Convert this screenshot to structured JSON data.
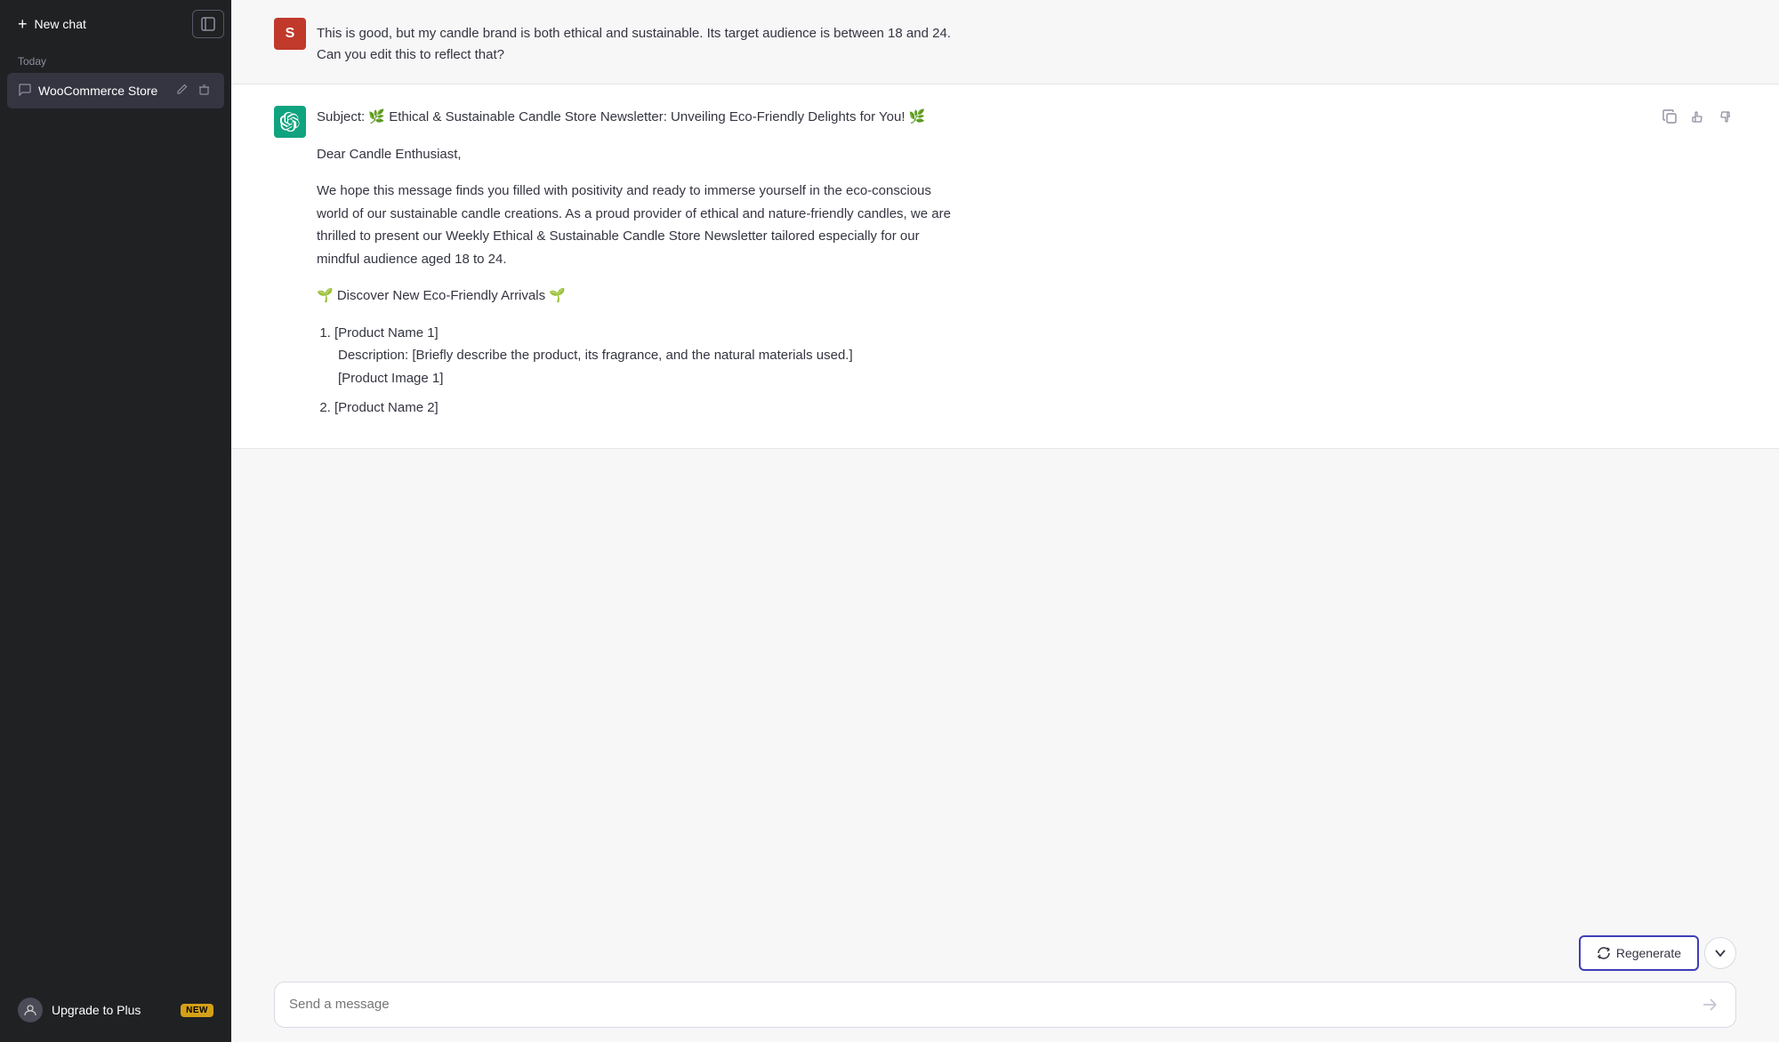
{
  "sidebar": {
    "new_chat_label": "New chat",
    "toggle_label": "⊞",
    "section_today": "Today",
    "chat_item_label": "WooCommerce Store",
    "upgrade_label": "Upgrade to Plus",
    "new_badge": "NEW"
  },
  "user_message": {
    "avatar_letter": "S",
    "text": "This is good, but my candle brand is both ethical and sustainable. Its target audience is between 18 and 24. Can you edit this to reflect that?"
  },
  "ai_message": {
    "subject": "Subject: 🌿 Ethical & Sustainable Candle Store Newsletter: Unveiling Eco-Friendly Delights for You! 🌿",
    "greeting": "Dear Candle Enthusiast,",
    "body": "We hope this message finds you filled with positivity and ready to immerse yourself in the eco-conscious world of our sustainable candle creations. As a proud provider of ethical and nature-friendly candles, we are thrilled to present our Weekly Ethical & Sustainable Candle Store Newsletter tailored especially for our mindful audience aged 18 to 24.",
    "section_header": "🌱 Discover New Eco-Friendly Arrivals 🌱",
    "products": [
      {
        "name": "[Product Name 1]",
        "description": "Description: [Briefly describe the product, its fragrance, and the natural materials used.]",
        "image": "[Product Image 1]"
      },
      {
        "name": "[Product Name 2]",
        "description": "",
        "image": ""
      }
    ],
    "actions": {
      "copy": "copy",
      "thumbup": "thumbs-up",
      "thumbdown": "thumbs-down"
    }
  },
  "input": {
    "placeholder": "Send a message"
  },
  "buttons": {
    "regenerate": "Regenerate"
  }
}
